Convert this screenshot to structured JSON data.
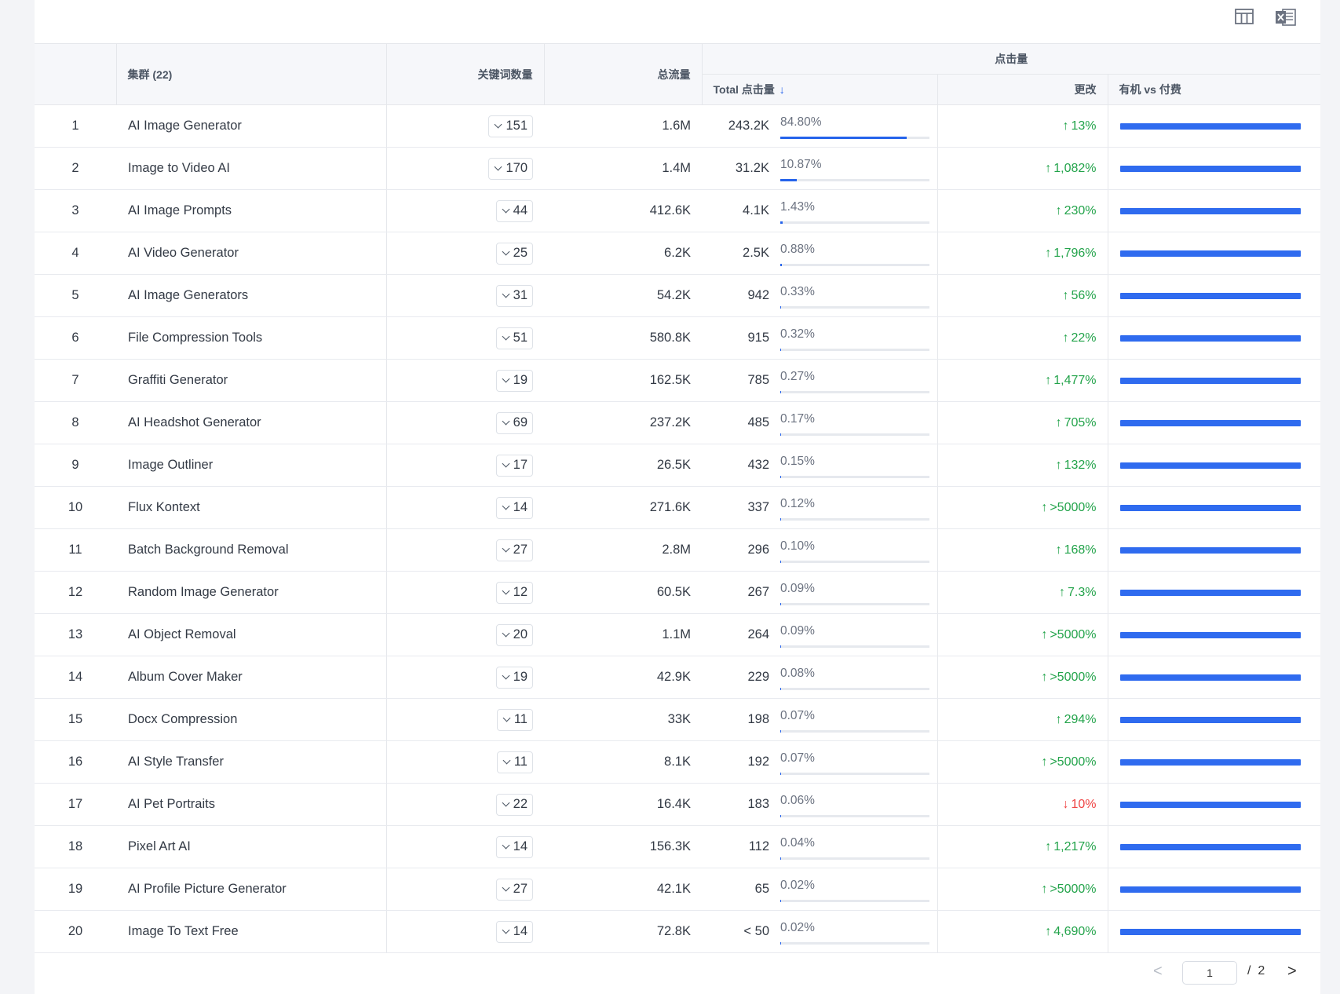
{
  "toolbar": {
    "columns_icon": "table-columns-icon",
    "export_icon": "excel-export-icon"
  },
  "table": {
    "headers": {
      "cluster": "集群 (22)",
      "keywords": "关键词数量",
      "traffic": "总流量",
      "clicks_group": "点击量",
      "total_clicks": "Total 点击量",
      "change": "更改",
      "organic_vs_paid": "有机 vs 付费"
    },
    "rows": [
      {
        "num": "1",
        "name": "AI Image Generator",
        "kw": "151",
        "traffic": "1.6M",
        "clicks": "243.2K",
        "share": "84.80%",
        "share_value": 84.8,
        "change": "13%",
        "dir": "up",
        "organic": 1
      },
      {
        "num": "2",
        "name": "Image to Video AI",
        "kw": "170",
        "traffic": "1.4M",
        "clicks": "31.2K",
        "share": "10.87%",
        "share_value": 10.87,
        "change": "1,082%",
        "dir": "up",
        "organic": 1
      },
      {
        "num": "3",
        "name": "AI Image Prompts",
        "kw": "44",
        "traffic": "412.6K",
        "clicks": "4.1K",
        "share": "1.43%",
        "share_value": 1.43,
        "change": "230%",
        "dir": "up",
        "organic": 1
      },
      {
        "num": "4",
        "name": "AI Video Generator",
        "kw": "25",
        "traffic": "6.2K",
        "clicks": "2.5K",
        "share": "0.88%",
        "share_value": 0.88,
        "change": "1,796%",
        "dir": "up",
        "organic": 1
      },
      {
        "num": "5",
        "name": "AI Image Generators",
        "kw": "31",
        "traffic": "54.2K",
        "clicks": "942",
        "share": "0.33%",
        "share_value": 0.33,
        "change": "56%",
        "dir": "up",
        "organic": 1
      },
      {
        "num": "6",
        "name": "File Compression Tools",
        "kw": "51",
        "traffic": "580.8K",
        "clicks": "915",
        "share": "0.32%",
        "share_value": 0.32,
        "change": "22%",
        "dir": "up",
        "organic": 1
      },
      {
        "num": "7",
        "name": "Graffiti Generator",
        "kw": "19",
        "traffic": "162.5K",
        "clicks": "785",
        "share": "0.27%",
        "share_value": 0.27,
        "change": "1,477%",
        "dir": "up",
        "organic": 1
      },
      {
        "num": "8",
        "name": "AI Headshot Generator",
        "kw": "69",
        "traffic": "237.2K",
        "clicks": "485",
        "share": "0.17%",
        "share_value": 0.17,
        "change": "705%",
        "dir": "up",
        "organic": 1
      },
      {
        "num": "9",
        "name": "Image Outliner",
        "kw": "17",
        "traffic": "26.5K",
        "clicks": "432",
        "share": "0.15%",
        "share_value": 0.15,
        "change": "132%",
        "dir": "up",
        "organic": 1
      },
      {
        "num": "10",
        "name": "Flux Kontext",
        "kw": "14",
        "traffic": "271.6K",
        "clicks": "337",
        "share": "0.12%",
        "share_value": 0.12,
        "change": ">5000%",
        "dir": "up",
        "organic": 1
      },
      {
        "num": "11",
        "name": "Batch Background Removal",
        "kw": "27",
        "traffic": "2.8M",
        "clicks": "296",
        "share": "0.10%",
        "share_value": 0.1,
        "change": "168%",
        "dir": "up",
        "organic": 1
      },
      {
        "num": "12",
        "name": "Random Image Generator",
        "kw": "12",
        "traffic": "60.5K",
        "clicks": "267",
        "share": "0.09%",
        "share_value": 0.09,
        "change": "7.3%",
        "dir": "up",
        "organic": 1
      },
      {
        "num": "13",
        "name": "AI Object Removal",
        "kw": "20",
        "traffic": "1.1M",
        "clicks": "264",
        "share": "0.09%",
        "share_value": 0.09,
        "change": ">5000%",
        "dir": "up",
        "organic": 1
      },
      {
        "num": "14",
        "name": "Album Cover Maker",
        "kw": "19",
        "traffic": "42.9K",
        "clicks": "229",
        "share": "0.08%",
        "share_value": 0.08,
        "change": ">5000%",
        "dir": "up",
        "organic": 1
      },
      {
        "num": "15",
        "name": "Docx Compression",
        "kw": "11",
        "traffic": "33K",
        "clicks": "198",
        "share": "0.07%",
        "share_value": 0.07,
        "change": "294%",
        "dir": "up",
        "organic": 1
      },
      {
        "num": "16",
        "name": "AI Style Transfer",
        "kw": "11",
        "traffic": "8.1K",
        "clicks": "192",
        "share": "0.07%",
        "share_value": 0.07,
        "change": ">5000%",
        "dir": "up",
        "organic": 1
      },
      {
        "num": "17",
        "name": "AI Pet Portraits",
        "kw": "22",
        "traffic": "16.4K",
        "clicks": "183",
        "share": "0.06%",
        "share_value": 0.06,
        "change": "10%",
        "dir": "down",
        "organic": 1
      },
      {
        "num": "18",
        "name": "Pixel Art AI",
        "kw": "14",
        "traffic": "156.3K",
        "clicks": "112",
        "share": "0.04%",
        "share_value": 0.04,
        "change": "1,217%",
        "dir": "up",
        "organic": 1
      },
      {
        "num": "19",
        "name": "AI Profile Picture Generator",
        "kw": "27",
        "traffic": "42.1K",
        "clicks": "65",
        "share": "0.02%",
        "share_value": 0.02,
        "change": ">5000%",
        "dir": "up",
        "organic": 1
      },
      {
        "num": "20",
        "name": "Image To Text Free",
        "kw": "14",
        "traffic": "72.8K",
        "clicks": "< 50",
        "share": "0.02%",
        "share_value": 0.02,
        "change": "4,690%",
        "dir": "up",
        "organic": 1
      }
    ]
  },
  "pagination": {
    "current": "1",
    "separator": "/",
    "total": "2"
  },
  "colors": {
    "accent": "#2563eb",
    "up": "#22a34a",
    "down": "#ef4444",
    "organic_bar": "#2f6bef"
  }
}
